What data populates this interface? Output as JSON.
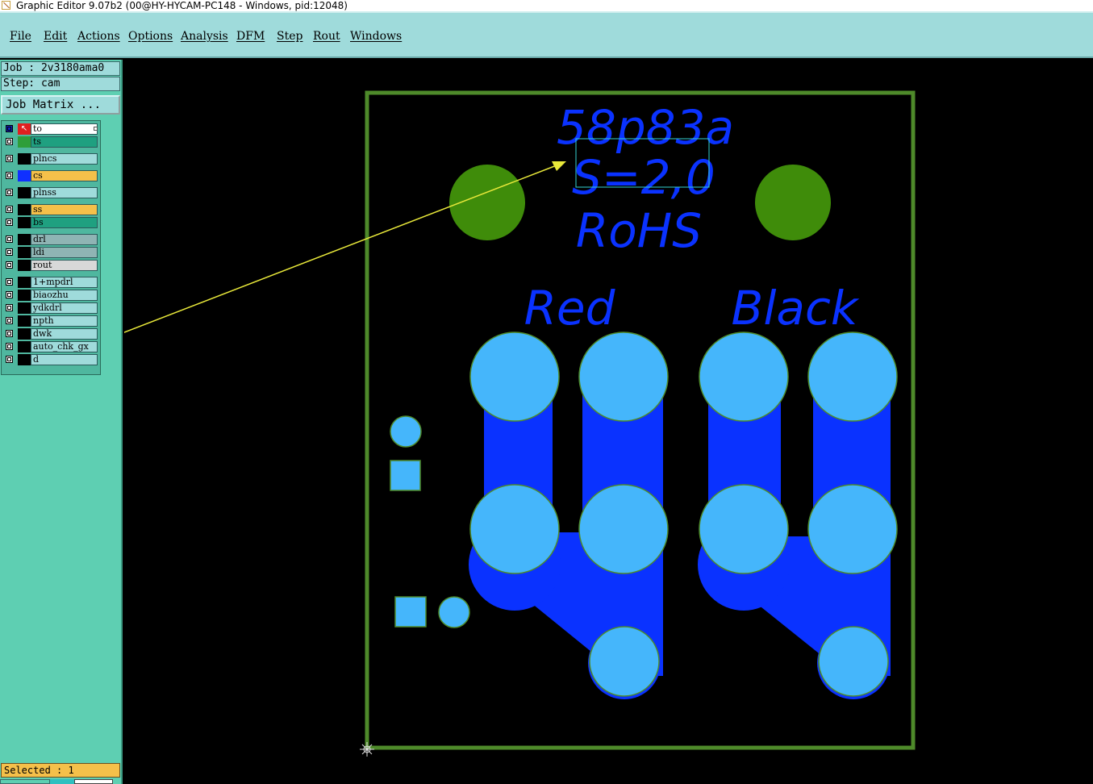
{
  "window": {
    "title": "Graphic Editor 9.07b2 (00@HY-HYCAM-PC148 - Windows, pid:12048)"
  },
  "menu": [
    "File",
    "Edit",
    "Actions",
    "Options",
    "Analysis",
    "DFM",
    "Step",
    "Rout",
    "Windows"
  ],
  "panel": {
    "job": "Job : 2v3180ama0",
    "step": "Step: cam",
    "job_matrix_button": "Job Matrix ...",
    "layers": [
      {
        "name": "to",
        "color": "#ffffff",
        "swatch": "#2e9e3a",
        "active": true
      },
      {
        "name": "ts",
        "color": "#1fa080",
        "swatch": "#2e9e3a"
      },
      {
        "name": "plncs",
        "color": "#9fdbdb",
        "swatch": "#000000"
      },
      {
        "name": "cs",
        "color": "#f5c04a",
        "swatch": "#1030ff"
      },
      {
        "name": "plnss",
        "color": "#9fdbdb",
        "swatch": "#000000"
      },
      {
        "name": "ss",
        "color": "#f5c04a",
        "swatch": "#000000"
      },
      {
        "name": "bs",
        "color": "#1fa080",
        "swatch": "#000000"
      },
      {
        "name": "drl",
        "color": "#8fb4b4",
        "swatch": "#000000"
      },
      {
        "name": "ldi",
        "color": "#8fb4b4",
        "swatch": "#000000"
      },
      {
        "name": "rout",
        "color": "#d8d8d8",
        "swatch": "#000000"
      },
      {
        "name": "1+mpdrl",
        "color": "#9fdbdb",
        "swatch": "#000000"
      },
      {
        "name": "biaozhu",
        "color": "#9fdbdb",
        "swatch": "#000000"
      },
      {
        "name": "ydkdrl",
        "color": "#9fdbdb",
        "swatch": "#000000"
      },
      {
        "name": "npth",
        "color": "#9fdbdb",
        "swatch": "#000000"
      },
      {
        "name": "dwk",
        "color": "#9fdbdb",
        "swatch": "#000000"
      },
      {
        "name": "auto_chk_gx",
        "color": "#9fdbdb",
        "swatch": "#000000"
      },
      {
        "name": "d",
        "color": "#9fdbdb",
        "swatch": "#000000"
      }
    ],
    "selected": "Selected : 1"
  },
  "board": {
    "texts": [
      "58p83a",
      "S=2,0",
      "RoHS",
      "Red",
      "Black"
    ],
    "colors": {
      "outline": "#4e8a2a",
      "pad": "#45b6fb",
      "copper": "#0a32ff",
      "silk": "#0a32ff",
      "fiducial": "#3f8c0a",
      "arrow": "#e8e83a",
      "selection": "#35d0d0"
    }
  }
}
